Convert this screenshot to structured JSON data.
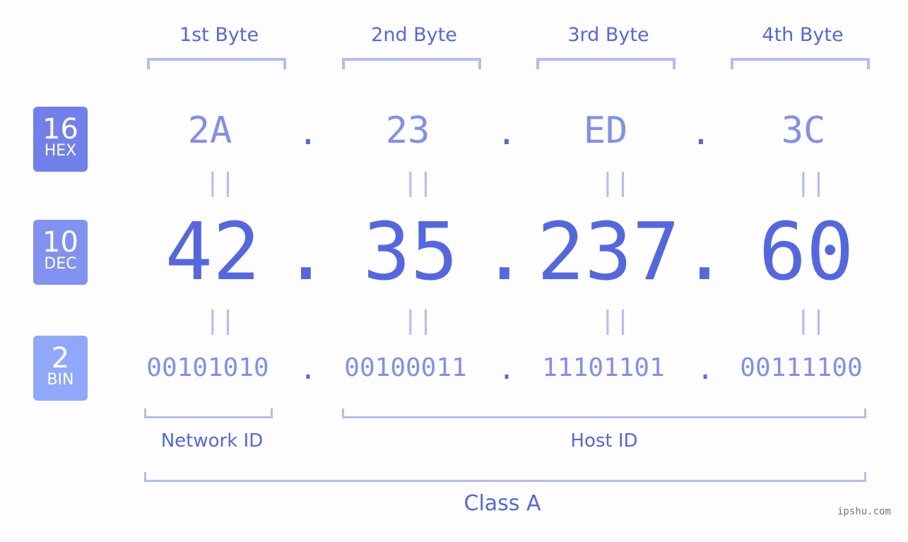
{
  "bytes": {
    "labels": [
      "1st Byte",
      "2nd Byte",
      "3rd Byte",
      "4th Byte"
    ]
  },
  "badges": {
    "hex": {
      "number": "16",
      "label": "HEX",
      "color": "#7280ea"
    },
    "dec": {
      "number": "10",
      "label": "DEC",
      "color": "#8292f0"
    },
    "bin": {
      "number": "2",
      "label": "BIN",
      "color": "#90a8f9"
    }
  },
  "ip": {
    "hex": [
      "2A",
      "23",
      "ED",
      "3C"
    ],
    "dec": [
      "42",
      "35",
      "237",
      "60"
    ],
    "bin": [
      "00101010",
      "00100011",
      "11101101",
      "00111100"
    ],
    "separator": ".",
    "equals": "="
  },
  "segments": {
    "network_id": "Network ID",
    "host_id": "Host ID",
    "class": "Class A"
  },
  "colors": {
    "accent": "#5567e0",
    "light": "#8190ec",
    "bracket": "#b3bcf5"
  },
  "watermark": "ipshu.com"
}
